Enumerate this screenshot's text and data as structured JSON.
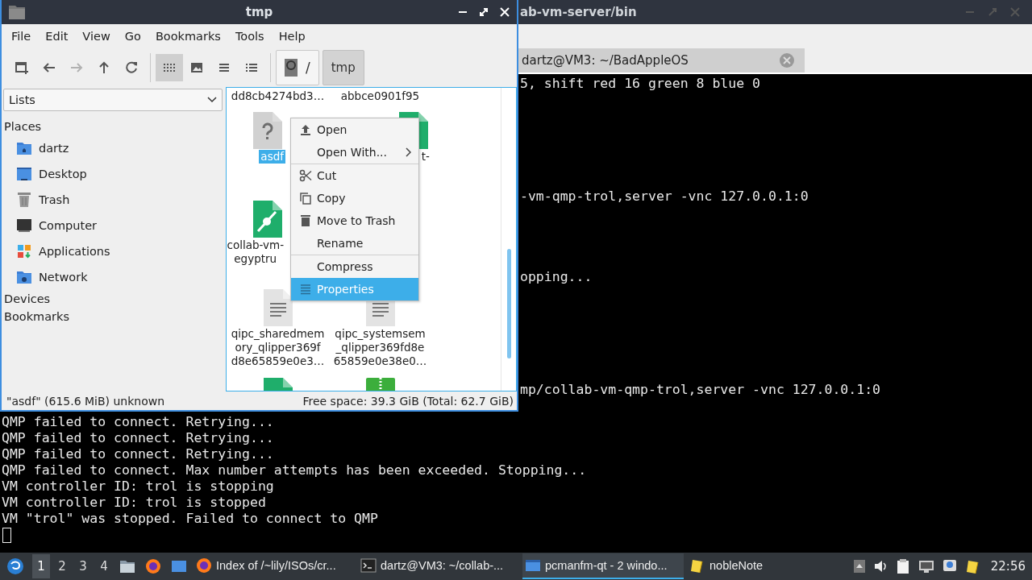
{
  "terminal": {
    "title": "ab-vm-server/bin",
    "tab": {
      "label": "dartz@VM3: ~/BadAppleOS"
    },
    "side_lines": [
      "5, shift red 16 green 8 blue 0",
      "-vm-qmp-trol,server -vnc 127.0.0.1:0",
      "opping...",
      "mp/collab-vm-qmp-trol,server -vnc 127.0.0.1:0"
    ],
    "lines": [
      "QMP failed to connect. Retrying...",
      "QMP failed to connect. Retrying...",
      "QMP failed to connect. Retrying...",
      "QMP failed to connect. Max number attempts has been exceeded. Stopping...",
      "VM controller ID: trol is stopping",
      "VM controller ID: trol is stopped",
      "VM \"trol\" was stopped. Failed to connect to QMP"
    ]
  },
  "file_manager": {
    "title": "tmp",
    "menu": [
      "File",
      "Edit",
      "View",
      "Go",
      "Bookmarks",
      "Tools",
      "Help"
    ],
    "nav_buttons": [
      {
        "kind": "new_tab",
        "disabled": false
      },
      {
        "kind": "back",
        "disabled": false
      },
      {
        "kind": "forward",
        "disabled": true
      },
      {
        "kind": "up",
        "disabled": false
      },
      {
        "kind": "reload",
        "disabled": false
      }
    ],
    "view_buttons": [
      {
        "kind": "icons",
        "selected": true
      },
      {
        "kind": "thumbnails",
        "selected": false
      },
      {
        "kind": "compact",
        "selected": false
      },
      {
        "kind": "detailed",
        "selected": false
      }
    ],
    "path": [
      {
        "kind": "root",
        "label": "/",
        "selected": false
      },
      {
        "kind": "folder",
        "label": "tmp",
        "selected": true
      }
    ],
    "sidebar": {
      "combo": "Lists",
      "sections": [
        {
          "title": "Places",
          "items": [
            {
              "kind": "home",
              "label": "dartz"
            },
            {
              "kind": "desktop",
              "label": "Desktop"
            },
            {
              "kind": "trash",
              "label": "Trash"
            },
            {
              "kind": "computer",
              "label": "Computer"
            },
            {
              "kind": "applications",
              "label": "Applications"
            },
            {
              "kind": "network",
              "label": "Network"
            }
          ]
        },
        {
          "title": "Devices"
        },
        {
          "title": "Bookmarks"
        }
      ]
    },
    "files": [
      {
        "items": [
          {
            "lines": [
              "dd8cb4274bd3…"
            ],
            "selected": false
          },
          {
            "lines": [
              "abbce0901f95"
            ],
            "selected": false
          }
        ]
      },
      {
        "items": [
          {
            "kind": "unknown",
            "lines": [
              "asdf"
            ],
            "selected": true
          },
          {
            "kind": "document",
            "lines": [
              "t-"
            ],
            "selected": false
          }
        ]
      },
      {
        "items": [
          {
            "kind": "link",
            "lines": [
              "collab-vm-",
              "egyptru"
            ],
            "selected": false
          }
        ]
      },
      {
        "items": [
          {
            "kind": "text",
            "lines": [
              "qipc_sharedmem",
              "ory_qlipper369f",
              "d8e65859e0e3…"
            ],
            "selected": false
          },
          {
            "kind": "text",
            "lines": [
              "qipc_systemsem",
              "_qlipper369fd8e",
              "65859e0e38e0…"
            ],
            "selected": false
          }
        ]
      },
      {
        "items": [
          {
            "kind": "document"
          },
          {
            "kind": "archive"
          }
        ]
      }
    ],
    "context_menu": [
      {
        "kind": "open",
        "label": "Open",
        "selected": false
      },
      {
        "kind": "submenu",
        "label": "Open With...",
        "selected": false
      },
      {
        "kind": "separator"
      },
      {
        "kind": "cut",
        "label": "Cut",
        "selected": false
      },
      {
        "kind": "copy",
        "label": "Copy",
        "selected": false
      },
      {
        "kind": "trash",
        "label": "Move to Trash",
        "selected": false
      },
      {
        "kind": "plain",
        "label": "Rename",
        "selected": false
      },
      {
        "kind": "separator"
      },
      {
        "kind": "plain",
        "label": "Compress",
        "selected": false
      },
      {
        "kind": "properties",
        "label": "Properties",
        "selected": true
      }
    ],
    "status": {
      "selection": "\"asdf\" (615.6 MiB) unknown",
      "free_space": "Free space: 39.3 GiB (Total: 62.7 GiB)"
    }
  },
  "taskbar": {
    "workspaces": [
      {
        "label": "1",
        "selected": true
      },
      {
        "label": "2",
        "selected": false
      },
      {
        "label": "3",
        "selected": false
      },
      {
        "label": "4",
        "selected": false
      }
    ],
    "launchers": [
      {
        "kind": "files"
      },
      {
        "kind": "browser"
      },
      {
        "kind": "desktop"
      }
    ],
    "tasks": [
      {
        "kind": "browser",
        "label": "Index of /~lily/ISOs/cr...",
        "selected": false
      },
      {
        "kind": "terminal",
        "label": "dartz@VM3: ~/collab-...",
        "selected": false
      },
      {
        "kind": "window",
        "label": "pcmanfm-qt - 2 windo...",
        "selected": true
      },
      {
        "kind": "note",
        "label": "nobleNote",
        "selected": false
      }
    ],
    "tray": [
      {
        "kind": "arrow"
      },
      {
        "kind": "volume"
      },
      {
        "kind": "clipboard"
      },
      {
        "kind": "network"
      },
      {
        "kind": "notification"
      },
      {
        "kind": "note"
      }
    ],
    "clock": "22:56"
  }
}
